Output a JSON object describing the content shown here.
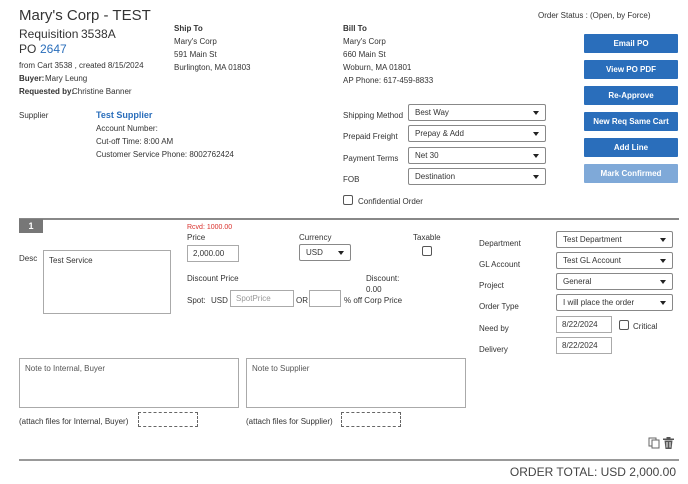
{
  "header": {
    "title": "Mary's Corp - TEST",
    "requisition_label": "Requisition",
    "requisition_no": "3538A",
    "po_label": "PO",
    "po_no": "2647",
    "from_cart": "from Cart 3538 , created 8/15/2024",
    "buyer_label": "Buyer:",
    "buyer": "Mary Leung",
    "requested_label": "Requested by:",
    "requested_by": "Christine Banner",
    "order_status": "Order Status : (Open, by Force)"
  },
  "ship_to": {
    "title": "Ship To",
    "lines": [
      "Mary's Corp",
      "591 Main St",
      "Burlington, MA 01803"
    ]
  },
  "bill_to": {
    "title": "Bill To",
    "lines": [
      "Mary's Corp",
      "660 Main St",
      "Woburn, MA 01801",
      "AP Phone: 617-459-8833"
    ]
  },
  "buttons": {
    "email_po": "Email PO",
    "view_pdf": "View PO PDF",
    "re_approve": "Re-Approve",
    "new_req": "New Req Same Cart",
    "add_line": "Add Line",
    "mark_confirmed": "Mark Confirmed"
  },
  "supplier": {
    "label": "Supplier",
    "name": "Test Supplier",
    "account": "Account Number:",
    "cutoff": "Cut-off Time: 8:00 AM",
    "phone": "Customer Service Phone: 8002762424"
  },
  "order_fields": {
    "shipping_method_label": "Shipping Method",
    "shipping_method": "Best Way",
    "prepaid_freight_label": "Prepaid Freight",
    "prepaid_freight": "Prepay & Add",
    "payment_terms_label": "Payment Terms",
    "payment_terms": "Net 30",
    "fob_label": "FOB",
    "fob": "Destination",
    "confidential_label": "Confidential Order"
  },
  "line": {
    "number": "1",
    "desc_label": "Desc",
    "desc": "Test Service",
    "rcvd": "Rcvd: 1000.00",
    "price_label": "Price",
    "price": "2,000.00",
    "currency_label": "Currency",
    "currency": "USD",
    "taxable_label": "Taxable",
    "discount_price_label": "Discount Price",
    "discount_label": "Discount:",
    "discount_value": "0.00",
    "spot_label": "Spot:",
    "usd": "USD",
    "spot_placeholder": "SpotPrice",
    "or": "OR",
    "pct_label": "% off Corp Price",
    "department_label": "Department",
    "department": "Test Department",
    "gl_label": "GL Account",
    "gl": "Test GL Account",
    "project_label": "Project",
    "project": "General",
    "order_type_label": "Order Type",
    "order_type": "I will place the order",
    "need_by_label": "Need by",
    "need_by": "8/22/2024",
    "critical_label": "Critical",
    "delivery_label": "Delivery",
    "delivery": "8/22/2024",
    "note_internal_placeholder": "Note to Internal, Buyer",
    "note_supplier_placeholder": "Note to Supplier",
    "attach_internal": "(attach files for Internal, Buyer)",
    "attach_supplier": "(attach files for Supplier)"
  },
  "order_total": "ORDER TOTAL: USD 2,000.00",
  "icons": {
    "copy": "copy-icon",
    "trash": "trash-icon"
  }
}
